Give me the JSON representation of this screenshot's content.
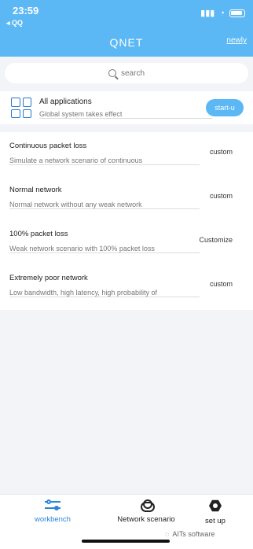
{
  "status_bar": {
    "time": "23:59",
    "back_label": "◂ QQ"
  },
  "header": {
    "title": "QNET",
    "newly_label": "newly"
  },
  "search": {
    "placeholder": "search"
  },
  "all_apps": {
    "title": "All applications",
    "subtitle": "Global system takes effect",
    "button_label": "start-u"
  },
  "scenarios": [
    {
      "title": "Continuous packet loss",
      "description": "Simulate a network scenario of continuous",
      "action": "custom"
    },
    {
      "title": "Normal network",
      "description": "Normal network without any weak network",
      "action": "custom"
    },
    {
      "title": "100% packet loss",
      "description": "Weak network scenario with 100% packet loss",
      "action": "Customize"
    },
    {
      "title": "Extremely poor network",
      "description": "Low bandwidth, high latency, high probability of",
      "action": "custom"
    }
  ],
  "tabbar": {
    "workbench": "workbench",
    "network_scenario": "Network scenario",
    "setup": "set up"
  },
  "footer": {
    "watermark": "AITs software"
  },
  "colors": {
    "accent": "#5bb8f4",
    "active_tab": "#2a86d8"
  }
}
